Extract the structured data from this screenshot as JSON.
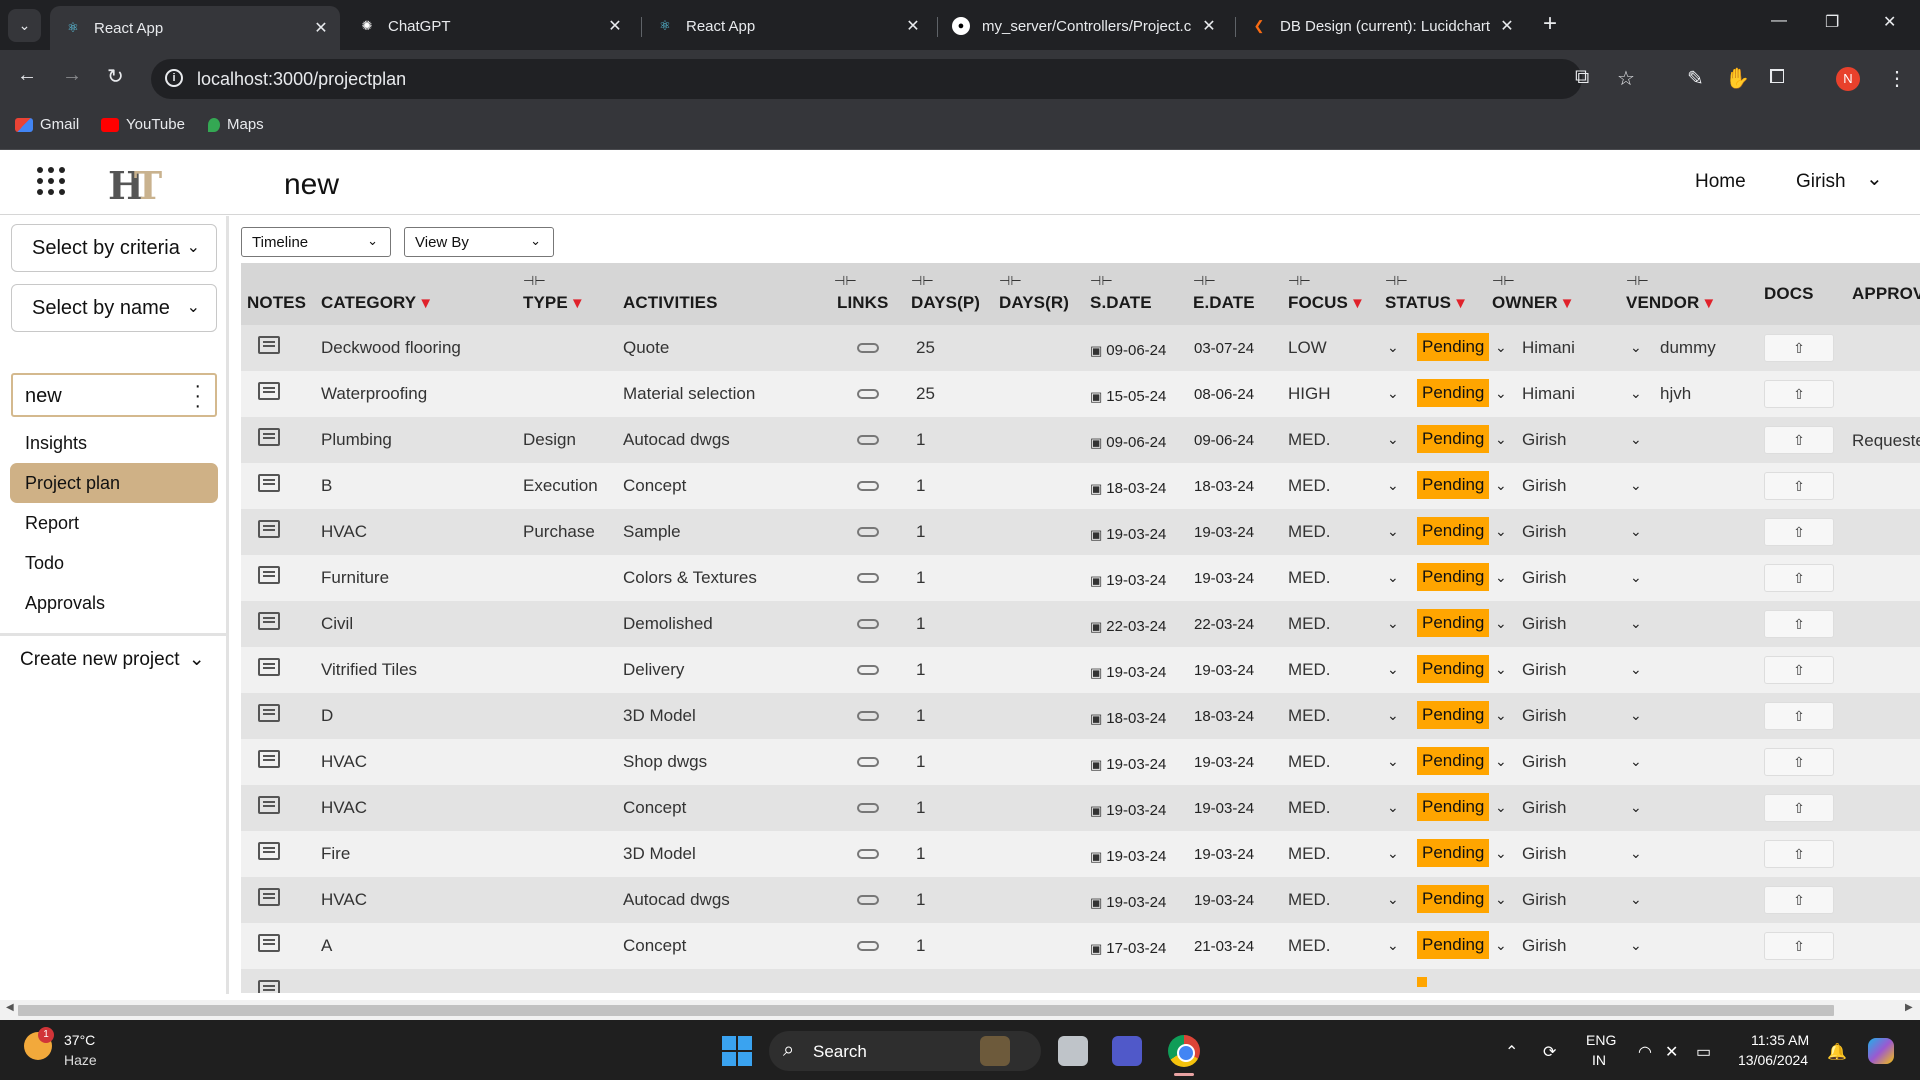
{
  "browser": {
    "tabs": [
      {
        "title": "React App",
        "active": true
      },
      {
        "title": "ChatGPT",
        "active": false
      },
      {
        "title": "React App",
        "active": false
      },
      {
        "title": "my_server/Controllers/Project.c",
        "active": false
      },
      {
        "title": "DB Design (current): Lucidchart",
        "active": false
      }
    ],
    "url": "localhost:3000/projectplan",
    "profile_initial": "N",
    "bookmarks": [
      "Gmail",
      "YouTube",
      "Maps"
    ]
  },
  "header": {
    "project_title": "new",
    "nav_home": "Home",
    "nav_user": "Girish"
  },
  "sidebar": {
    "select_criteria": "Select by criteria",
    "select_name": "Select by name",
    "search_value": "new",
    "items": [
      "Insights",
      "Project plan",
      "Report",
      "Todo",
      "Approvals"
    ],
    "active_item": "Project plan",
    "create_new": "Create new project"
  },
  "filters": {
    "timeline": "Timeline",
    "view_by": "View By"
  },
  "table": {
    "headers": {
      "notes": "NOTES",
      "category": "CATEGORY",
      "type": "TYPE",
      "activities": "ACTIVITIES",
      "links": "LINKS",
      "days_p": "DAYS(P)",
      "days_r": "DAYS(R)",
      "s_date": "S.DATE",
      "e_date": "E.DATE",
      "focus": "FOCUS",
      "status": "STATUS",
      "owner": "OWNER",
      "vendor": "VENDOR",
      "docs": "DOCS",
      "approval": "APPROV"
    },
    "rows": [
      {
        "category": "Deckwood flooring",
        "type": "",
        "activity": "Quote",
        "days_p": "25",
        "s_date": "09-06-24",
        "e_date": "03-07-24",
        "focus": "LOW",
        "status": "Pending",
        "owner": "Himani",
        "vendor": "dummy",
        "approval": ""
      },
      {
        "category": "Waterproofing",
        "type": "",
        "activity": "Material selection",
        "days_p": "25",
        "s_date": "15-05-24",
        "e_date": "08-06-24",
        "focus": "HIGH",
        "status": "Pending",
        "owner": "Himani",
        "vendor": "hjvh",
        "approval": ""
      },
      {
        "category": "Plumbing",
        "type": "Design",
        "activity": "Autocad dwgs",
        "days_p": "1",
        "s_date": "09-06-24",
        "e_date": "09-06-24",
        "focus": "MED.",
        "status": "Pending",
        "owner": "Girish",
        "vendor": "",
        "approval": "Requeste"
      },
      {
        "category": "B",
        "type": "Execution",
        "activity": "Concept",
        "days_p": "1",
        "s_date": "18-03-24",
        "e_date": "18-03-24",
        "focus": "MED.",
        "status": "Pending",
        "owner": "Girish",
        "vendor": "",
        "approval": ""
      },
      {
        "category": "HVAC",
        "type": "Purchase",
        "activity": "Sample",
        "days_p": "1",
        "s_date": "19-03-24",
        "e_date": "19-03-24",
        "focus": "MED.",
        "status": "Pending",
        "owner": "Girish",
        "vendor": "",
        "approval": ""
      },
      {
        "category": "Furniture",
        "type": "",
        "activity": "Colors & Textures",
        "days_p": "1",
        "s_date": "19-03-24",
        "e_date": "19-03-24",
        "focus": "MED.",
        "status": "Pending",
        "owner": "Girish",
        "vendor": "",
        "approval": ""
      },
      {
        "category": "Civil",
        "type": "",
        "activity": "Demolished",
        "days_p": "1",
        "s_date": "22-03-24",
        "e_date": "22-03-24",
        "focus": "MED.",
        "status": "Pending",
        "owner": "Girish",
        "vendor": "",
        "approval": ""
      },
      {
        "category": "Vitrified Tiles",
        "type": "",
        "activity": "Delivery",
        "days_p": "1",
        "s_date": "19-03-24",
        "e_date": "19-03-24",
        "focus": "MED.",
        "status": "Pending",
        "owner": "Girish",
        "vendor": "",
        "approval": ""
      },
      {
        "category": "D",
        "type": "",
        "activity": "3D Model",
        "days_p": "1",
        "s_date": "18-03-24",
        "e_date": "18-03-24",
        "focus": "MED.",
        "status": "Pending",
        "owner": "Girish",
        "vendor": "",
        "approval": ""
      },
      {
        "category": "HVAC",
        "type": "",
        "activity": "Shop dwgs",
        "days_p": "1",
        "s_date": "19-03-24",
        "e_date": "19-03-24",
        "focus": "MED.",
        "status": "Pending",
        "owner": "Girish",
        "vendor": "",
        "approval": ""
      },
      {
        "category": "HVAC",
        "type": "",
        "activity": "Concept",
        "days_p": "1",
        "s_date": "19-03-24",
        "e_date": "19-03-24",
        "focus": "MED.",
        "status": "Pending",
        "owner": "Girish",
        "vendor": "",
        "approval": ""
      },
      {
        "category": "Fire",
        "type": "",
        "activity": "3D Model",
        "days_p": "1",
        "s_date": "19-03-24",
        "e_date": "19-03-24",
        "focus": "MED.",
        "status": "Pending",
        "owner": "Girish",
        "vendor": "",
        "approval": ""
      },
      {
        "category": "HVAC",
        "type": "",
        "activity": "Autocad dwgs",
        "days_p": "1",
        "s_date": "19-03-24",
        "e_date": "19-03-24",
        "focus": "MED.",
        "status": "Pending",
        "owner": "Girish",
        "vendor": "",
        "approval": ""
      },
      {
        "category": "A",
        "type": "",
        "activity": "Concept",
        "days_p": "1",
        "s_date": "17-03-24",
        "e_date": "21-03-24",
        "focus": "MED.",
        "status": "Pending",
        "owner": "Girish",
        "vendor": "",
        "approval": ""
      }
    ]
  },
  "taskbar": {
    "weather_temp": "37°C",
    "weather_desc": "Haze",
    "weather_badge": "1",
    "search_label": "Search",
    "lang1": "ENG",
    "lang2": "IN",
    "time": "11:35 AM",
    "date": "13/06/2024"
  },
  "colors": {
    "accent": "#cfb186",
    "pending": "#ffa500",
    "filter": "#e0222b",
    "chrome_bg": "#35363a"
  }
}
